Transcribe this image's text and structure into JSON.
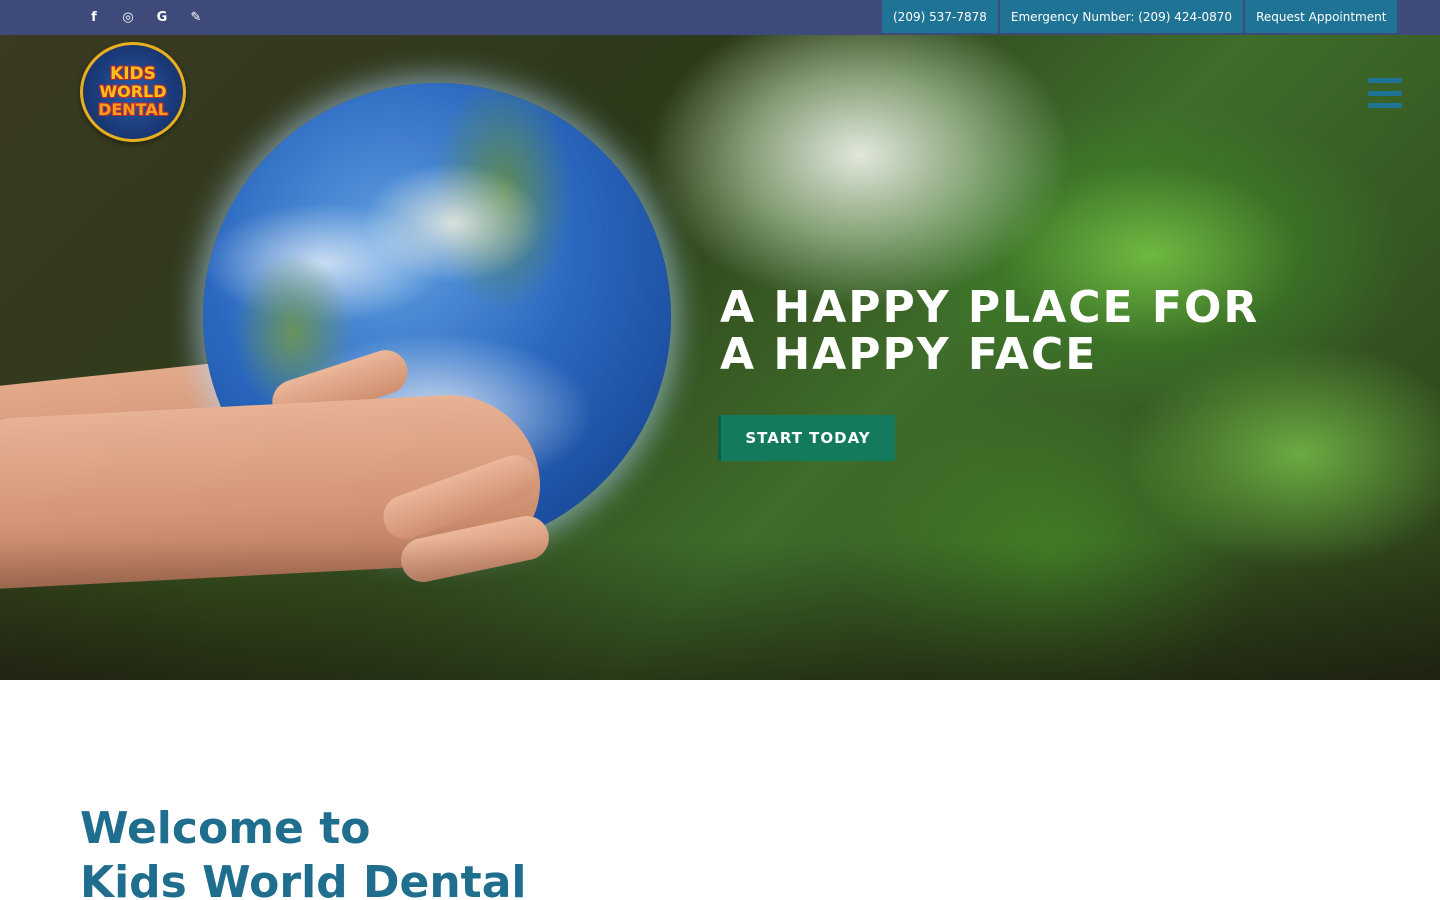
{
  "topbar": {
    "social": [
      {
        "icon": "facebook-icon",
        "glyph": "f"
      },
      {
        "icon": "instagram-icon",
        "glyph": "◎"
      },
      {
        "icon": "google-icon",
        "glyph": "G"
      },
      {
        "icon": "blog-icon",
        "glyph": "✎"
      }
    ],
    "links": [
      {
        "label": "(209) 537-7878"
      },
      {
        "label": "Emergency Number: (209) 424-0870"
      },
      {
        "label": "Request Appointment"
      }
    ]
  },
  "logo": {
    "line1": "KIDS",
    "line2": "WORLD",
    "line3": "DENTAL"
  },
  "hero": {
    "title_line1": "A Happy Place For",
    "title_line2": "A Happy Face",
    "cta_label": "START TODAY"
  },
  "welcome": {
    "line1": "Welcome to",
    "line2": "Kids World Dental"
  },
  "colors": {
    "topbar": "#3e4a7a",
    "utility_link": "#1f7496",
    "cta": "#137a5e",
    "heading": "#1f6e8e"
  }
}
